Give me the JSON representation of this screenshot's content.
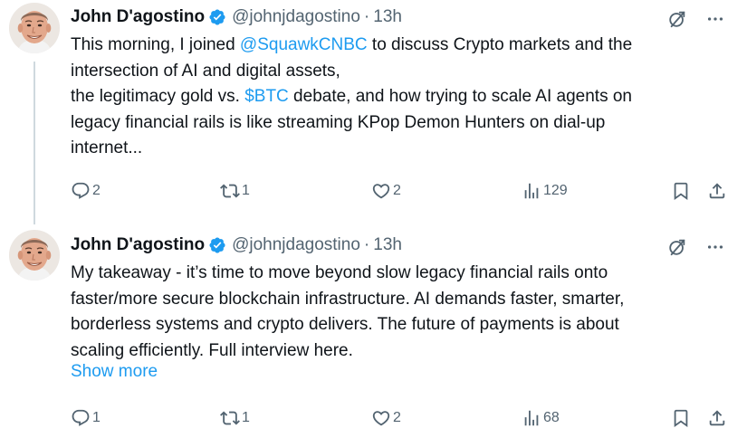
{
  "tweets": [
    {
      "author": {
        "name": "John D'agostino",
        "handle": "@johnjdagostino",
        "separator": "·",
        "time": "13h"
      },
      "body": {
        "line1": {
          "pre": "This morning, I joined ",
          "mention": "@SquawkCNBC",
          "post": " to discuss Crypto markets and the"
        },
        "line2": "intersection of AI and digital assets,",
        "line3": {
          "pre": "the legitimacy gold vs. ",
          "cashtag": "$BTC",
          "post": " debate, and how trying to scale AI agents on"
        },
        "line4": "legacy financial rails is like streaming KPop Demon Hunters on dial-up",
        "line5": "internet..."
      },
      "stats": {
        "replies": "2",
        "reposts": "1",
        "likes": "2",
        "views": "129"
      }
    },
    {
      "author": {
        "name": "John D'agostino",
        "handle": "@johnjdagostino",
        "separator": "·",
        "time": "13h"
      },
      "body": {
        "line1": "My takeaway - it’s time to move beyond slow legacy financial rails onto",
        "line2": "faster/more secure blockchain infrastructure. AI demands faster, smarter,",
        "line3": "borderless systems and crypto delivers. The future of payments is  about",
        "line4": "scaling efficiently. Full interview here."
      },
      "show_more": "Show more",
      "stats": {
        "replies": "1",
        "reposts": "1",
        "likes": "2",
        "views": "68"
      }
    }
  ],
  "colors": {
    "link": "#1d9bf0",
    "muted": "#536471",
    "text": "#0f1419",
    "verified": "#1d9bf0",
    "thread_line": "#cfd9de"
  },
  "icons": [
    "avatar",
    "verified-badge-icon",
    "grok-icon",
    "more-icon",
    "reply-icon",
    "repost-icon",
    "like-icon",
    "views-icon",
    "bookmark-icon",
    "share-icon"
  ]
}
